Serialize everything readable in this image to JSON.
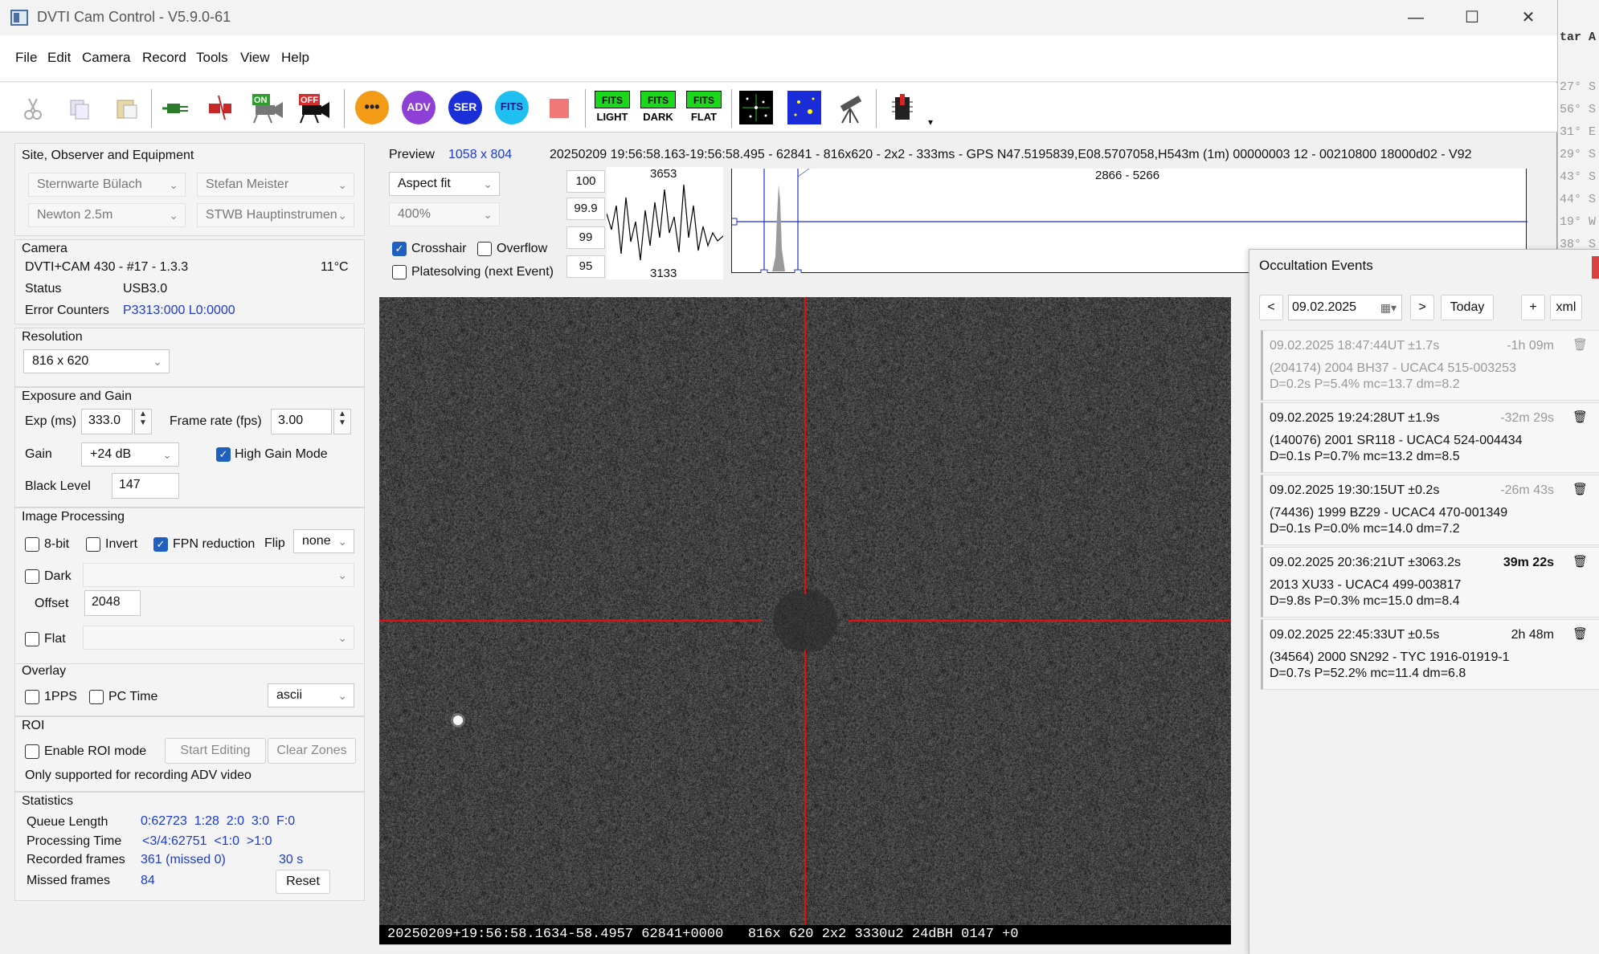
{
  "window": {
    "title": "DVTI Cam Control - V5.9.0-61",
    "minimize": "—",
    "maximize": "☐",
    "close": "✕"
  },
  "menu": [
    "File",
    "Edit",
    "Camera",
    "Record",
    "Tools",
    "View",
    "Help"
  ],
  "toolbar": {
    "adv": "ADV",
    "ser": "SER",
    "fits": "FITS",
    "fits_light": "LIGHT",
    "fits_dark": "DARK",
    "fits_flat": "FLAT",
    "on": "ON",
    "off": "OFF",
    "dropdown": "▾"
  },
  "site": {
    "title": "Site, Observer and Equipment",
    "site": "Sternwarte Bülach",
    "observer": "Stefan Meister",
    "telescope": "Newton 2.5m",
    "instrument": "STWB Hauptinstrumen"
  },
  "camera": {
    "title": "Camera",
    "model": "DVTI+CAM 430  -  #17  -  1.3.3",
    "temp": "11°C",
    "status_label": "Status",
    "status_value": "USB3.0",
    "errors_label": "Error Counters",
    "errors_value": "P3313:000 L0:0000"
  },
  "resolution": {
    "title": "Resolution",
    "value": "816 x 620"
  },
  "exposure": {
    "title": "Exposure and Gain",
    "exp_label": "Exp (ms)",
    "exp_value": "333.0",
    "fps_label": "Frame rate (fps)",
    "fps_value": "3.00",
    "gain_label": "Gain",
    "gain_value": "+24 dB",
    "high_gain_label": "High Gain Mode",
    "black_label": "Black Level",
    "black_value": "147"
  },
  "image_processing": {
    "title": "Image Processing",
    "bit8": "8-bit",
    "invert": "Invert",
    "fpn": "FPN reduction",
    "flip_label": "Flip",
    "flip_value": "none",
    "dark": "Dark",
    "offset_label": "Offset",
    "offset_value": "2048",
    "flat": "Flat"
  },
  "overlay": {
    "title": "Overlay",
    "pps": "1PPS",
    "pctime": "PC Time",
    "mode": "ascii"
  },
  "roi": {
    "title": "ROI",
    "enable": "Enable ROI mode",
    "start": "Start Editing",
    "clear": "Clear Zones",
    "note": "Only supported for recording ADV video"
  },
  "statistics": {
    "title": "Statistics",
    "queue_label": "Queue Length",
    "queue_value": "0:62723  1:28  2:0  3:0  F:0",
    "proc_label": "Processing Time",
    "proc_value": "<3/4:62751  <1:0  >1:0",
    "rec_label": "Recorded frames",
    "rec_value": "361 (missed 0)",
    "rec_time": "30 s",
    "missed_label": "Missed frames",
    "missed_value": "84",
    "reset": "Reset"
  },
  "preview": {
    "label": "Preview",
    "size": "1058 x 804",
    "info": "20250209 19:56:58.163-19:56:58.495 - 62841 - 816x620 - 2x2 - 333ms - GPS N47.5195839,E08.5707058,H543m (1m) 00000003 12 - 00210800 18000d02 - V92",
    "fit": "Aspect fit",
    "zoom": "400%",
    "crosshair": "Crosshair",
    "overflow": "Overflow",
    "platesolving": "Platesolving (next Event)",
    "levels": [
      "100",
      "99.9",
      "99",
      "95"
    ],
    "graph_max": "3653",
    "graph_min": "3133",
    "hist_range": "2866 - 5266"
  },
  "osd": "20250209+19:56:58.1634-58.4957 62841+0000   816x 620 2x2 3330u2 24dBH 0147 +0",
  "occultation": {
    "title": "Occultation Events",
    "prev": "<",
    "date": "09.02.2025",
    "next": ">",
    "today": "Today",
    "add": "+",
    "xml": "xml",
    "events": [
      {
        "time": "09.02.2025 18:47:44UT ±1.7s",
        "rel": "-1h 09m",
        "object": "(204174) 2004 BH37 - UCAC4 515-003253",
        "details": "D=0.2s   P=5.4%   mc=13.7   dm=8.2"
      },
      {
        "time": "09.02.2025 19:24:28UT ±1.9s",
        "rel": "-32m 29s",
        "object": "(140076) 2001 SR118 - UCAC4 524-004434",
        "details": "D=0.1s   P=0.7%   mc=13.2   dm=8.5"
      },
      {
        "time": "09.02.2025 19:30:15UT ±0.2s",
        "rel": "-26m 43s",
        "object": "(74436) 1999 BZ29 - UCAC4 470-001349",
        "details": "D=0.1s   P=0.0%   mc=14.0   dm=7.2"
      },
      {
        "time": "09.02.2025 20:36:21UT ±3063.2s",
        "rel": "39m 22s",
        "object": "2013 XU33 - UCAC4 499-003817",
        "details": "D=9.8s   P=0.3%   mc=15.0   dm=8.4"
      },
      {
        "time": "09.02.2025 22:45:33UT ±0.5s",
        "rel": "2h 48m",
        "object": "(34564) 2000 SN292 - TYC 1916-01919-1",
        "details": "D=0.7s   P=52.2%   mc=11.4   dm=6.8"
      }
    ]
  },
  "background_window": {
    "title": "tar A",
    "lines": [
      "27° S",
      "56° S",
      "31° E",
      "29° S",
      "43° S",
      "44° S",
      "19° W",
      "38° S"
    ]
  }
}
